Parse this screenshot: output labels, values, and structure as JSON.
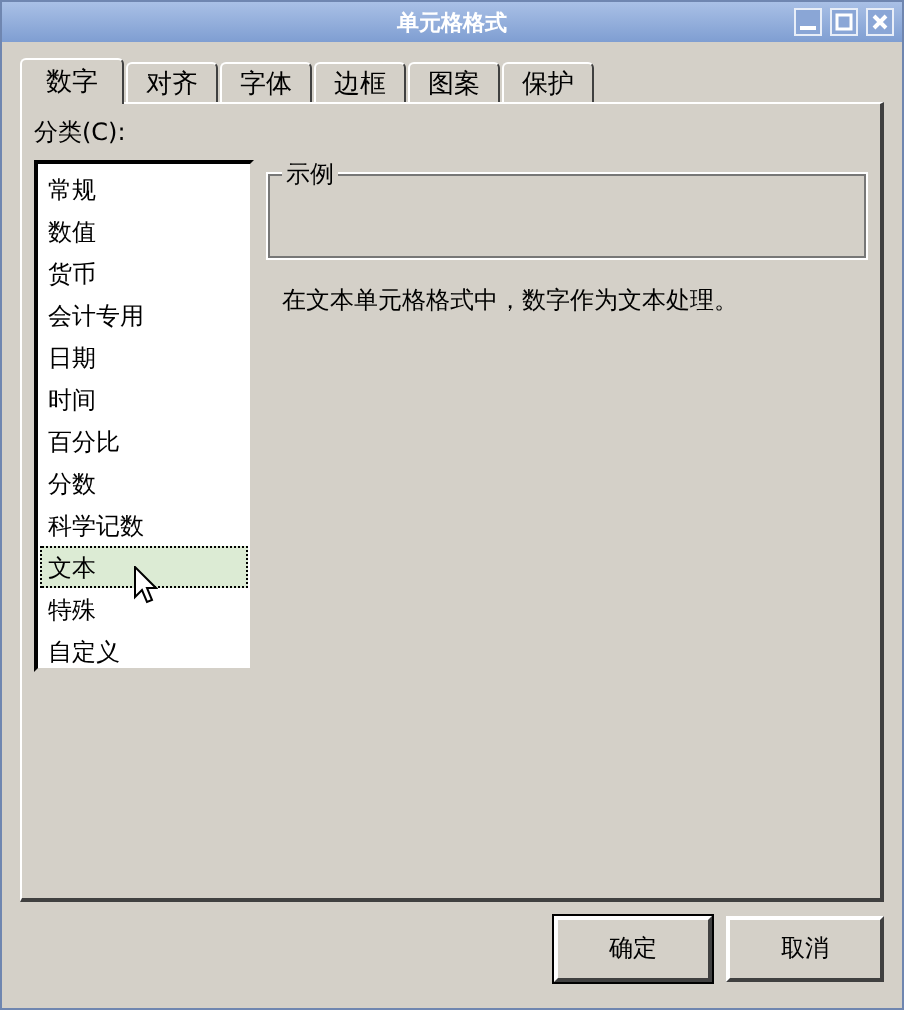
{
  "window": {
    "title": "单元格格式"
  },
  "tabs": [
    {
      "label": "数字",
      "selected": true
    },
    {
      "label": "对齐",
      "selected": false
    },
    {
      "label": "字体",
      "selected": false
    },
    {
      "label": "边框",
      "selected": false
    },
    {
      "label": "图案",
      "selected": false
    },
    {
      "label": "保护",
      "selected": false
    }
  ],
  "category": {
    "label": "分类(C):",
    "items": [
      {
        "label": "常规",
        "selected": false
      },
      {
        "label": "数值",
        "selected": false
      },
      {
        "label": "货币",
        "selected": false
      },
      {
        "label": "会计专用",
        "selected": false
      },
      {
        "label": "日期",
        "selected": false
      },
      {
        "label": "时间",
        "selected": false
      },
      {
        "label": "百分比",
        "selected": false
      },
      {
        "label": "分数",
        "selected": false
      },
      {
        "label": "科学记数",
        "selected": false
      },
      {
        "label": "文本",
        "selected": true
      },
      {
        "label": "特殊",
        "selected": false
      },
      {
        "label": "自定义",
        "selected": false
      }
    ]
  },
  "sample": {
    "title": "示例"
  },
  "description": "在文本单元格格式中，数字作为文本处理。",
  "buttons": [
    {
      "label": "确定",
      "kind": "default"
    },
    {
      "label": "取消",
      "kind": "normal"
    }
  ]
}
